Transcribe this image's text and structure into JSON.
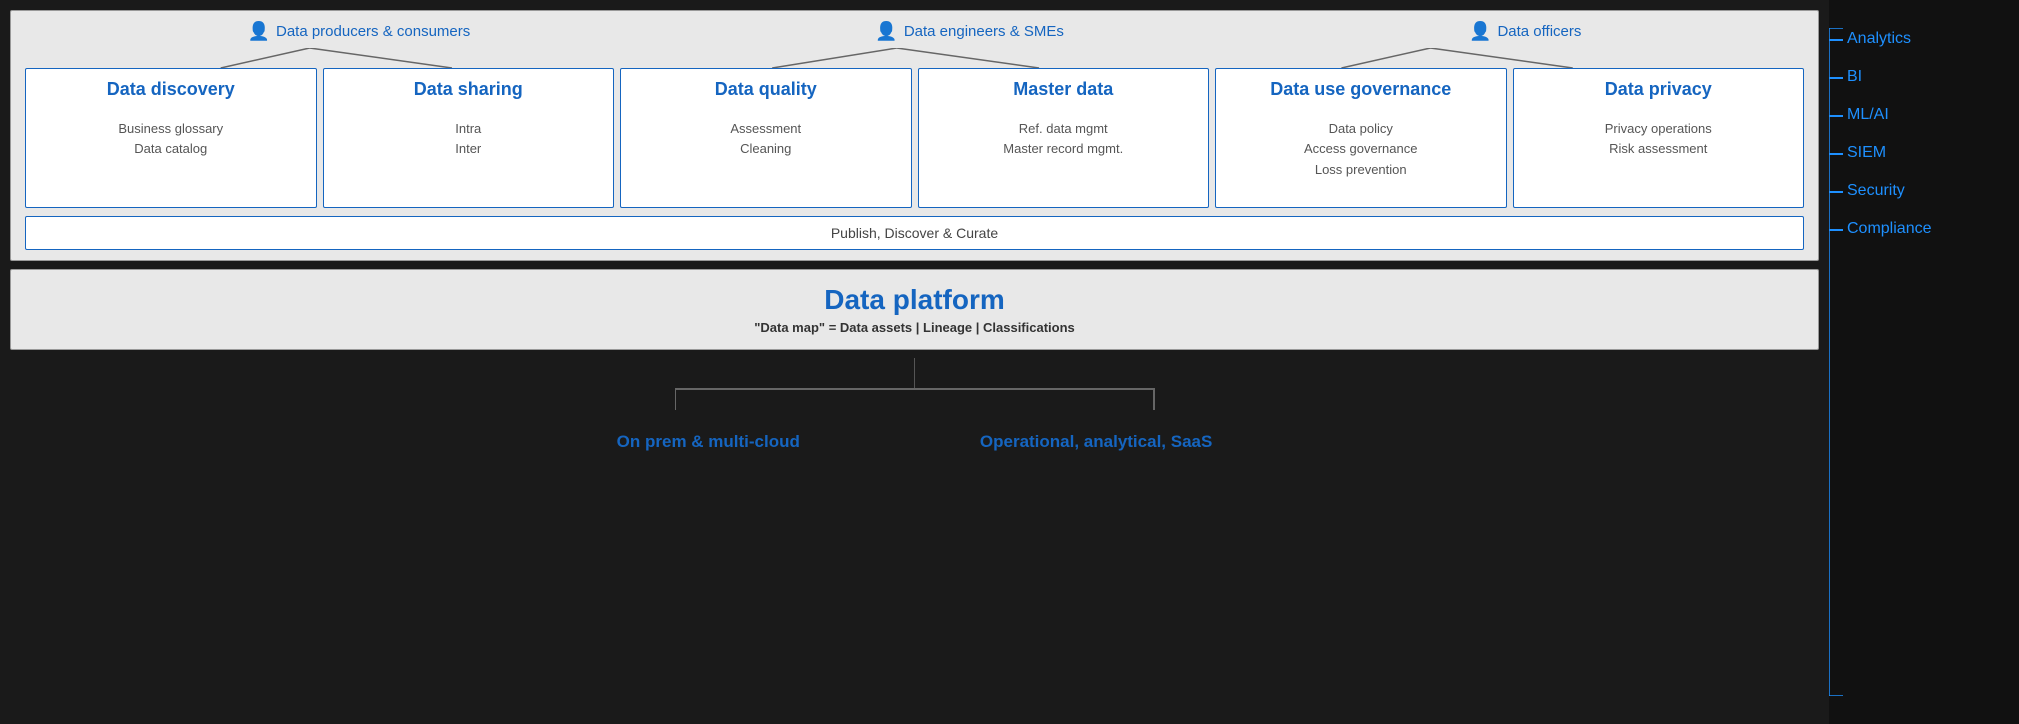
{
  "personas": [
    {
      "id": "data-producers",
      "icon": "👤",
      "label": "Data producers & consumers"
    },
    {
      "id": "data-engineers",
      "icon": "👤",
      "label": "Data engineers & SMEs"
    },
    {
      "id": "data-officers",
      "icon": "👤",
      "label": "Data officers"
    }
  ],
  "cards": [
    {
      "id": "data-discovery",
      "title": "Data discovery",
      "subtitles": [
        "Business glossary",
        "Data catalog"
      ]
    },
    {
      "id": "data-sharing",
      "title": "Data sharing",
      "subtitles": [
        "Intra",
        "Inter"
      ]
    },
    {
      "id": "data-quality",
      "title": "Data quality",
      "subtitles": [
        "Assessment",
        "Cleaning"
      ]
    },
    {
      "id": "master-data",
      "title": "Master data",
      "subtitles": [
        "Ref. data mgmt",
        "Master record mgmt."
      ]
    },
    {
      "id": "data-use-governance",
      "title": "Data use governance",
      "subtitles": [
        "Data policy",
        "Access governance",
        "Loss prevention"
      ]
    },
    {
      "id": "data-privacy",
      "title": "Data privacy",
      "subtitles": [
        "Privacy operations",
        "Risk assessment"
      ]
    }
  ],
  "publish_bar": "Publish, Discover & Curate",
  "platform": {
    "title": "Data platform",
    "subtitle": "\"Data map\" = Data assets | Lineage | Classifications"
  },
  "sources": [
    {
      "id": "on-prem",
      "label": "On prem & multi-cloud"
    },
    {
      "id": "operational",
      "label": "Operational, analytical, SaaS"
    }
  ],
  "sidebar": {
    "items": [
      {
        "id": "analytics",
        "label": "Analytics"
      },
      {
        "id": "bi",
        "label": "BI"
      },
      {
        "id": "ml-ai",
        "label": "ML/AI"
      },
      {
        "id": "siem",
        "label": "SIEM"
      },
      {
        "id": "security",
        "label": "Security"
      },
      {
        "id": "compliance",
        "label": "Compliance"
      }
    ]
  }
}
